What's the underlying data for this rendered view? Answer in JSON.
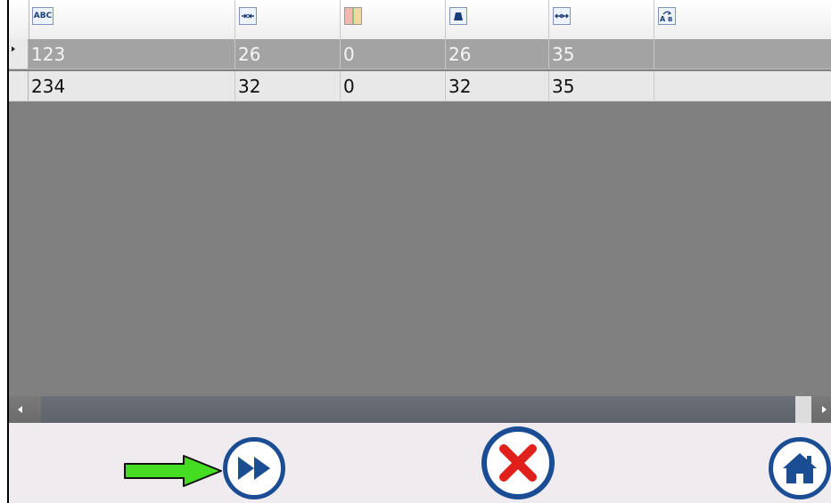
{
  "grid": {
    "columns": [
      {
        "icon": "abc-text-icon",
        "label": "ABC"
      },
      {
        "icon": "diameter-icon",
        "label": ""
      },
      {
        "icon": "color-strip-icon",
        "label": ""
      },
      {
        "icon": "weight-icon",
        "label": ""
      },
      {
        "icon": "width-icon",
        "label": ""
      },
      {
        "icon": "a-to-b-icon",
        "label": ""
      }
    ],
    "rows": [
      {
        "selected": true,
        "cells": [
          "123",
          "26",
          "0",
          "26",
          "35",
          ""
        ]
      },
      {
        "selected": false,
        "cells": [
          "234",
          "32",
          "0",
          "32",
          "35",
          ""
        ]
      }
    ]
  },
  "toolbar": {
    "next_icon": "fast-forward-icon",
    "cancel_icon": "cancel-x-icon",
    "home_icon": "home-icon",
    "hint_arrow_color": "#44dd22",
    "button_border_color": "#1b4d94",
    "cancel_color": "#e0201a"
  }
}
